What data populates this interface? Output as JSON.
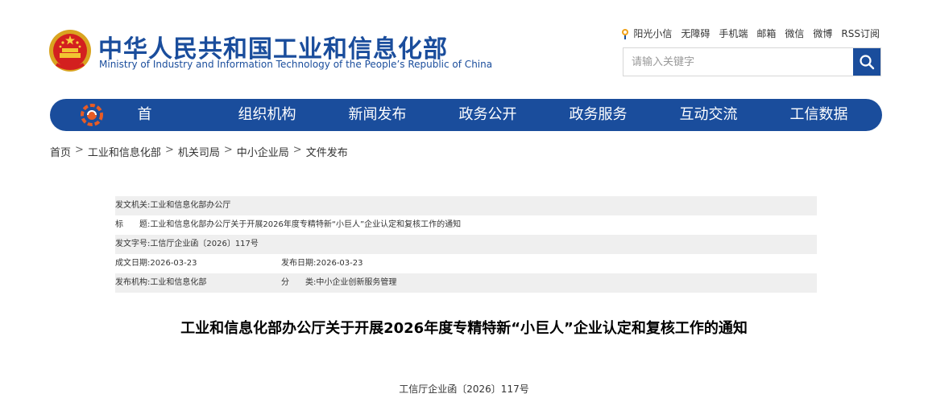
{
  "header": {
    "site_title": "中华人民共和国工业和信息化部",
    "site_subtitle": "Ministry of Industry and Information Technology of the People’s Republic of China",
    "toplinks": [
      "阳光小信",
      "无障碍",
      "手机端",
      "邮箱",
      "微信",
      "微博",
      "RSS订阅"
    ],
    "search_placeholder": "请输入关键字"
  },
  "nav": {
    "items": [
      "首页",
      "组织机构",
      "新闻发布",
      "政务公开",
      "政务服务",
      "互动交流",
      "工信数据"
    ]
  },
  "breadcrumb": [
    "首页",
    "工业和信息化部",
    "机关司局",
    "中小企业局",
    "文件发布"
  ],
  "breadcrumb_sep": ">",
  "meta": {
    "issuer_label": "发文机关:",
    "issuer": "工业和信息化部办公厅",
    "title_label": "标　　题:",
    "title": "工业和信息化部办公厅关于开展2026年度专精特新“小巨人”企业认定和复核工作的通知",
    "docno_label": "发文字号:",
    "docno": "工信厅企业函〔2026〕117号",
    "created_label": "成文日期:",
    "created": "2026-03-23",
    "published_label": "发布日期:",
    "published": "2026-03-23",
    "agency_label": "发布机构:",
    "agency": "工业和信息化部",
    "category_label": "分　　类:",
    "category": "中小企业创新服务管理"
  },
  "document": {
    "title": "工业和信息化部办公厅关于开展2026年度专精特新“小巨人”企业认定和复核工作的通知",
    "number": "工信厅企业函〔2026〕117号"
  },
  "colors": {
    "brand_blue": "#1a4d9c",
    "row_shade": "#efefef"
  },
  "icons": [
    "national-emblem-icon",
    "sun-icon",
    "search-icon",
    "nav-logo-icon"
  ]
}
